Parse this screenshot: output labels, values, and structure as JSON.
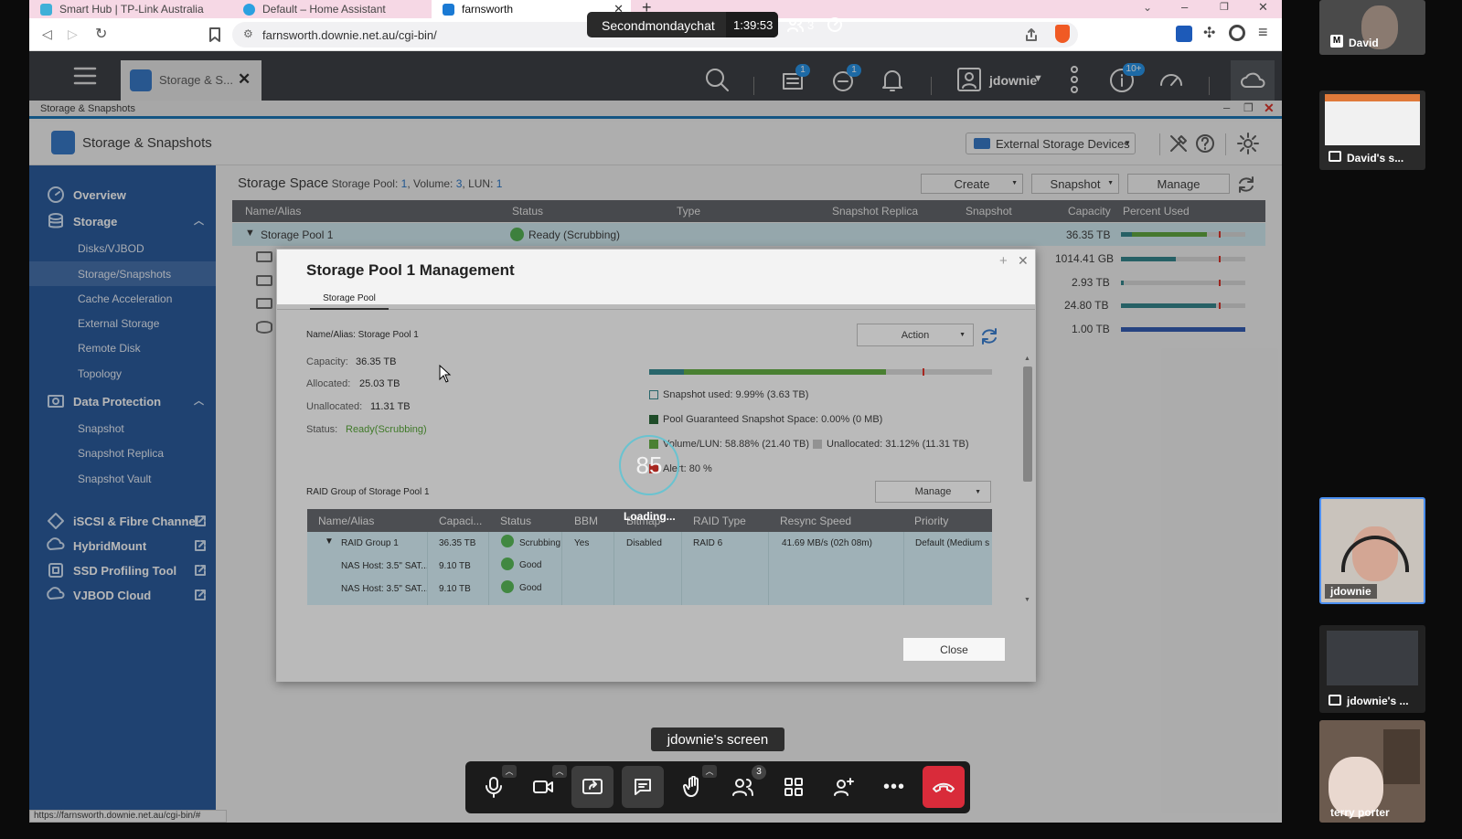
{
  "browser": {
    "tabs": [
      {
        "label": "Smart Hub | TP-Link Australia",
        "icon": "tplink-icon"
      },
      {
        "label": "Default – Home Assistant",
        "icon": "home-assistant-icon"
      },
      {
        "label": "farnsworth",
        "icon": "qnap-icon",
        "active": true
      }
    ],
    "url": "farnsworth.downie.net.au/cgi-bin/",
    "status_url": "https://farnsworth.downie.net.au/cgi-bin/#"
  },
  "meeting": {
    "title": "Secondmondaychat",
    "timer": "1:39:53",
    "participants": "3",
    "share_banner": "jdownie's screen",
    "participants_badge": "3",
    "tiles": [
      {
        "name": "David"
      },
      {
        "name": "David's s..."
      },
      {
        "name": "jdownie"
      },
      {
        "name": "jdownie's ..."
      },
      {
        "name": "terry porter"
      }
    ]
  },
  "qts": {
    "app_tab": "Storage & S...",
    "user": "jdownie",
    "badges": {
      "tasks": "1",
      "sync": "1",
      "notifications": "10+"
    },
    "window_title": "Storage & Snapshots",
    "app_title": "Storage & Snapshots",
    "external_devices": "External Storage Devices",
    "sidebar": {
      "overview": "Overview",
      "storage": "Storage",
      "storage_items": [
        "Disks/VJBOD",
        "Storage/Snapshots",
        "Cache Acceleration",
        "External Storage",
        "Remote Disk",
        "Topology"
      ],
      "data_protection": "Data Protection",
      "dp_items": [
        "Snapshot",
        "Snapshot Replica",
        "Snapshot Vault"
      ],
      "links": [
        "iSCSI & Fibre Channel",
        "HybridMount",
        "SSD Profiling Tool",
        "VJBOD Cloud"
      ]
    },
    "storage_space": {
      "title": "Storage Space",
      "pool_label": "Storage Pool:",
      "pool_count": "1",
      "volume_label": ", Volume:",
      "volume_count": "3",
      "lun_label": ", LUN:",
      "lun_count": "1",
      "buttons": {
        "create": "Create",
        "snapshot": "Snapshot",
        "manage": "Manage"
      },
      "columns": [
        "Name/Alias",
        "Status",
        "Type",
        "Snapshot Replica",
        "Snapshot",
        "Capacity",
        "Percent Used"
      ],
      "pool_row": {
        "name": "Storage Pool 1",
        "status": "Ready (Scrubbing)",
        "capacity": "36.35 TB"
      },
      "capacities": [
        "1014.41 GB",
        "2.93 TB",
        "24.80 TB",
        "1.00 TB"
      ]
    },
    "dialog": {
      "title": "Storage Pool 1 Management",
      "tab": "Storage Pool",
      "name_alias": "Name/Alias: Storage Pool 1",
      "action": "Action",
      "capacity_label": "Capacity:",
      "capacity": "36.35 TB",
      "allocated_label": "Allocated:",
      "allocated": "25.03 TB",
      "unallocated_label": "Unallocated:",
      "unallocated": "11.31 TB",
      "status_label": "Status:",
      "status": "Ready(Scrubbing)",
      "legend": {
        "snapshot_used": "Snapshot used: 9.99% (3.63 TB)",
        "guaranteed": "Pool Guaranteed Snapshot Space: 0.00% (0 MB)",
        "volume_lun": "Volume/LUN: 58.88% (21.40 TB)",
        "unallocated": "Unallocated: 31.12% (11.31 TB)",
        "alert": "Alert: 80 %"
      },
      "loading_value": "85",
      "loading_text": "Loading...",
      "raid_title": "RAID Group of Storage Pool 1",
      "manage": "Manage",
      "raid_columns": [
        "Name/Alias",
        "Capaci...",
        "Status",
        "BBM",
        "Bitmap",
        "RAID Type",
        "Resync Speed",
        "Priority"
      ],
      "raid_rows": [
        {
          "name": "RAID Group 1",
          "capacity": "36.35 TB",
          "status": "Scrubbing",
          "bbm": "Yes",
          "bitmap": "Disabled",
          "raid": "RAID 6",
          "speed": "41.69 MB/s (02h 08m)",
          "priority": "Default (Medium s"
        },
        {
          "name": "NAS Host: 3.5\" SAT...",
          "capacity": "9.10 TB",
          "status": "Good"
        },
        {
          "name": "NAS Host: 3.5\" SAT...",
          "capacity": "9.10 TB",
          "status": "Good"
        }
      ],
      "close": "Close"
    }
  },
  "colors": {
    "sidebar": "#1f5398",
    "accent": "#0f6fb3",
    "ok_green": "#4cae4c",
    "bar_teal": "#2a7f86",
    "bar_green": "#58a336",
    "alert_red": "#d9281e",
    "end_call": "#d92b3a"
  }
}
